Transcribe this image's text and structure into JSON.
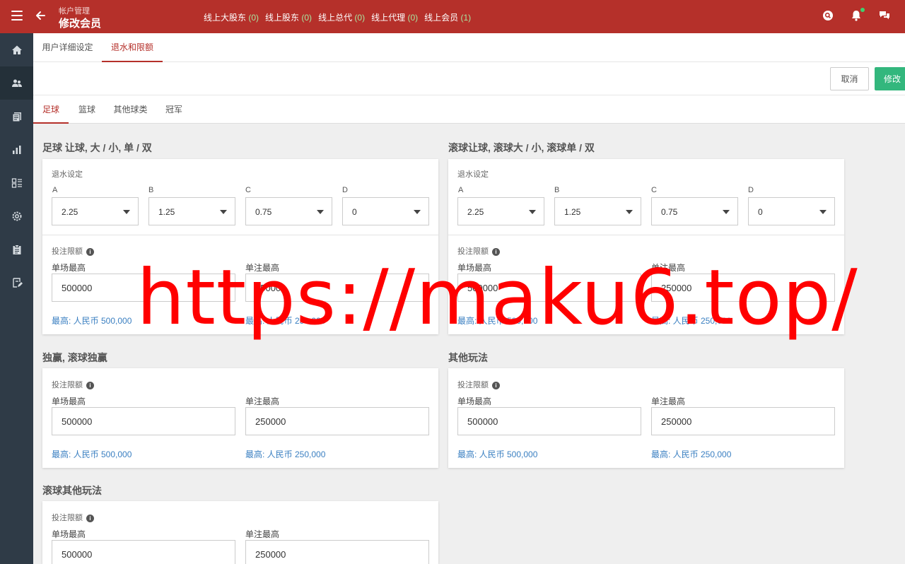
{
  "header": {
    "breadcrumb": "帐户管理",
    "title": "修改会员",
    "online": [
      {
        "label": "线上大股东",
        "count": "(0)"
      },
      {
        "label": "线上股东",
        "count": "(0)"
      },
      {
        "label": "线上总代",
        "count": "(0)"
      },
      {
        "label": "线上代理",
        "count": "(0)"
      },
      {
        "label": "线上会员",
        "count": "(1)"
      }
    ],
    "icons": [
      "search-icon",
      "bell-icon",
      "chat-icon"
    ]
  },
  "sidebar": {
    "items": [
      "home-icon",
      "users-icon",
      "documents-icon",
      "bar-chart-icon",
      "list-icon",
      "settings-icon",
      "clipboard-icon",
      "edit-document-icon"
    ],
    "active_index": 1
  },
  "tabs_top": [
    {
      "label": "用户详细设定",
      "active": false
    },
    {
      "label": "退水和限额",
      "active": true
    }
  ],
  "actions": {
    "cancel": "取消",
    "save": "修改"
  },
  "tabs_sport": [
    {
      "label": "足球",
      "active": true
    },
    {
      "label": "篮球",
      "active": false
    },
    {
      "label": "其他球类",
      "active": false
    },
    {
      "label": "冠军",
      "active": false
    }
  ],
  "colors": {
    "brand": "#b5302a",
    "sidebar": "#2f3b47",
    "save": "#33b77d",
    "link": "#3a7fc1",
    "watermark": "#ff0000"
  },
  "sections": {
    "s1": {
      "title": "足球 让球, 大 / 小, 单 / 双",
      "rebate_label": "退水设定",
      "rebate": [
        {
          "letter": "A",
          "value": "2.25"
        },
        {
          "letter": "B",
          "value": "1.25"
        },
        {
          "letter": "C",
          "value": "0.75"
        },
        {
          "letter": "D",
          "value": "0"
        }
      ],
      "limit_label": "投注限额",
      "match_max_label": "单场最高",
      "match_max_value": "500000",
      "match_max_note": "最高: 人民币 500,000",
      "bet_max_label": "单注最高",
      "bet_max_value": "250000",
      "bet_max_note": "最高: 人民币 250,000"
    },
    "s2": {
      "title": "滚球让球, 滚球大 / 小, 滚球单 / 双",
      "rebate_label": "退水设定",
      "rebate": [
        {
          "letter": "A",
          "value": "2.25"
        },
        {
          "letter": "B",
          "value": "1.25"
        },
        {
          "letter": "C",
          "value": "0.75"
        },
        {
          "letter": "D",
          "value": "0"
        }
      ],
      "limit_label": "投注限额",
      "match_max_label": "单场最高",
      "match_max_value": "500000",
      "match_max_note": "最高: 人民币 500,000",
      "bet_max_label": "单注最高",
      "bet_max_value": "250000",
      "bet_max_note": "最高: 人民币 250,000"
    },
    "s3": {
      "title": "独赢, 滚球独赢",
      "limit_label": "投注限额",
      "match_max_label": "单场最高",
      "match_max_value": "500000",
      "match_max_note": "最高: 人民币 500,000",
      "bet_max_label": "单注最高",
      "bet_max_value": "250000",
      "bet_max_note": "最高: 人民币 250,000"
    },
    "s4": {
      "title": "其他玩法",
      "limit_label": "投注限额",
      "match_max_label": "单场最高",
      "match_max_value": "500000",
      "match_max_note": "最高: 人民币 500,000",
      "bet_max_label": "单注最高",
      "bet_max_value": "250000",
      "bet_max_note": "最高: 人民币 250,000"
    },
    "s5": {
      "title": "滚球其他玩法",
      "limit_label": "投注限额",
      "match_max_label": "单场最高",
      "match_max_value": "500000",
      "bet_max_label": "单注最高",
      "bet_max_value": "250000"
    }
  },
  "watermark": "https://maku6.top/"
}
